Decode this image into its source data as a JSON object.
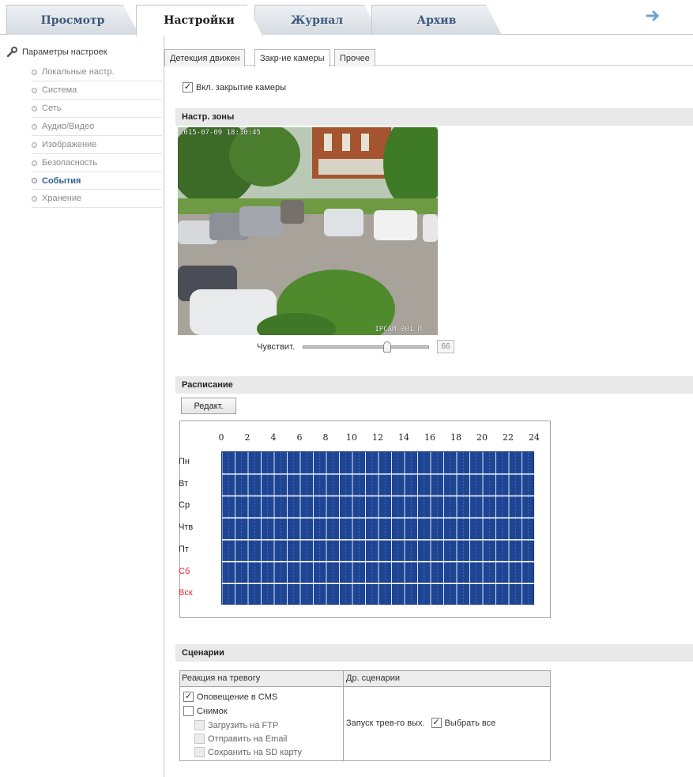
{
  "top_tabs": [
    {
      "label": "Просмотр",
      "active": false
    },
    {
      "label": "Настройки",
      "active": true
    },
    {
      "label": "Журнал",
      "active": false
    },
    {
      "label": "Архив",
      "active": false
    }
  ],
  "sidebar": {
    "title": "Параметры настроек",
    "items": [
      {
        "label": "Локальные настр.",
        "active": false
      },
      {
        "label": "Система",
        "active": false
      },
      {
        "label": "Сеть",
        "active": false
      },
      {
        "label": "Аудио/Видео",
        "active": false
      },
      {
        "label": "Изображение",
        "active": false
      },
      {
        "label": "Безопасность",
        "active": false
      },
      {
        "label": "События",
        "active": true
      },
      {
        "label": "Хранение",
        "active": false
      }
    ]
  },
  "sub_tabs": [
    {
      "label": "Детекция движен",
      "active": false
    },
    {
      "label": "Закр-ие камеры",
      "active": true
    },
    {
      "label": "Прочее",
      "active": false
    }
  ],
  "enable": {
    "label": "Вкл. закрытие камеры",
    "checked": true
  },
  "zone": {
    "section_title": "Настр. зоны",
    "timestamp": "2015-07-09 18:30:45",
    "camera_name": "IPCAM-001 П",
    "sensitivity_label": "Чувствит.",
    "sensitivity_value": "66",
    "sensitivity_percent": 66
  },
  "schedule": {
    "section_title": "Расписание",
    "edit_label": "Редакт.",
    "hours": [
      "0",
      "2",
      "4",
      "6",
      "8",
      "10",
      "12",
      "14",
      "16",
      "18",
      "20",
      "22",
      "24"
    ],
    "days": [
      {
        "label": "Пн",
        "weekend": false
      },
      {
        "label": "Вт",
        "weekend": false
      },
      {
        "label": "Ср",
        "weekend": false
      },
      {
        "label": "Чтв",
        "weekend": false
      },
      {
        "label": "Пт",
        "weekend": false
      },
      {
        "label": "Сб",
        "weekend": true
      },
      {
        "label": "Вск",
        "weekend": true
      }
    ],
    "fill_color": "#1e4593",
    "weekend_color": "#e3282d"
  },
  "scenarios": {
    "section_title": "Сценарии",
    "col_alarm": "Реакция на тревогу",
    "col_other": "Др. сценарии",
    "options": {
      "cms": {
        "label": "Оповещение в CMS",
        "checked": true
      },
      "snapshot": {
        "label": "Снимок",
        "checked": false
      },
      "ftp": {
        "label": "Загрузить на FTP",
        "checked": false
      },
      "email": {
        "label": "Отправить на Email",
        "checked": false
      },
      "sd": {
        "label": "Сохранить на SD карту",
        "checked": false
      }
    },
    "alarm_out_label": "Запуск трев-го вых.",
    "select_all": {
      "label": "Выбрать все",
      "checked": true
    }
  }
}
